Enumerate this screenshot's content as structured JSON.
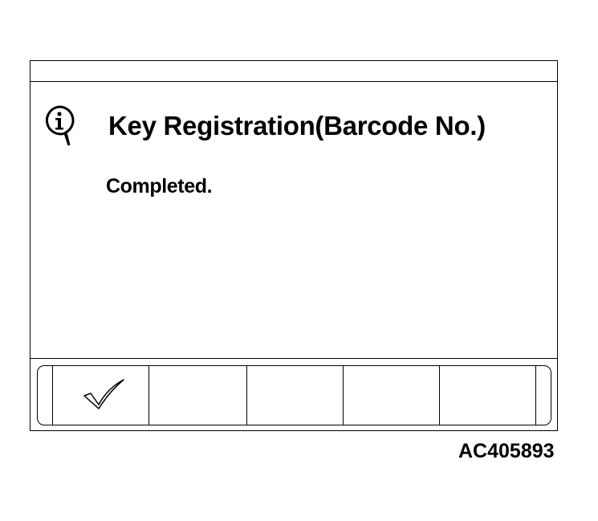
{
  "dialog": {
    "title": "Key Registration(Barcode No.)",
    "message": "Completed.",
    "icon": "info-speech-bubble-icon"
  },
  "softkeys": [
    {
      "label": "",
      "icon": "checkmark-icon"
    },
    {
      "label": ""
    },
    {
      "label": ""
    },
    {
      "label": ""
    },
    {
      "label": ""
    }
  ],
  "figure_code": "AC405893"
}
